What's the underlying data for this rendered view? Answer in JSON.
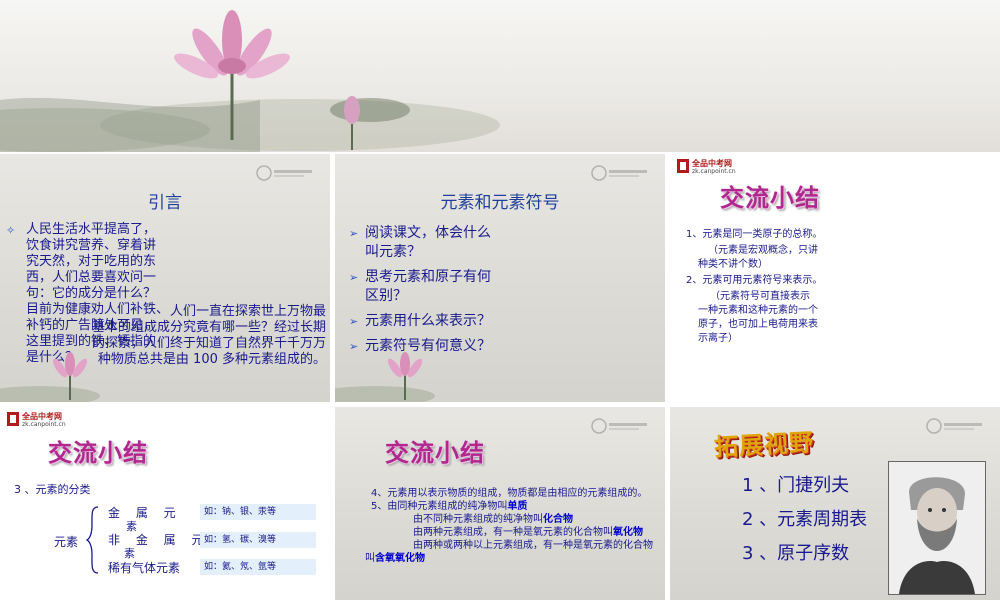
{
  "slides": {
    "s1": {
      "title": "引言",
      "bullet": "人民生活水平提高了，饮食讲究营养、穿着讲究天然，对于吃用的东西，人们总要喜欢问一句：它的成分是什么？目前为健康劝人们补铁、补钙的广告随处可见，这里提到的铁、钙指的是什么？",
      "bullet_lines": [
        "人民生活水平提高了，",
        "饮食讲究营养、穿着讲",
        "究天然，对于吃用的东",
        "西，人们总要喜欢问一",
        "句：它的成分是什么？",
        "目前为健康劝人们补铁、",
        "补钙的广告随处可见，",
        "这里提到的铁、钙指的",
        "是什么？"
      ],
      "overlay_lines": [
        "人们一直在探索世上万物最",
        "基本的组成成分究竟有哪一些？经过长期",
        "的探索，人们终于知道了自然界千千万万",
        "种物质总共是由 100 多种元素组成的。"
      ]
    },
    "s2": {
      "title": "元素和元素符号",
      "bullets": [
        [
          "阅读课文，体会什么",
          "叫元素？"
        ],
        [
          "思考元素和原子有何",
          "区别？"
        ],
        [
          "元素用什么来表示？"
        ],
        [
          "元素符号有何意义？"
        ]
      ]
    },
    "s3": {
      "logo_text": "全品中考网",
      "logo_sub": "zk.canpoint.cn",
      "title": "交流小结",
      "lines": [
        "1、元素是同一类原子的总称。",
        "（元素是宏观概念，只讲",
        "种类不讲个数）",
        "2、元素可用元素符号来表示。",
        "（元素符号可直接表示",
        "一种元素和这种元素的一个",
        "原子，也可加上电荷用来表",
        "示离子）"
      ]
    },
    "s4": {
      "logo_text": "全品中考网",
      "logo_sub": "zk.canpoint.cn",
      "title": "交流小结",
      "heading": "3 、元素的分类",
      "root_label": "元素",
      "categories": [
        {
          "label_main": "金 属 元",
          "label_wrap": "素",
          "examples": "如：钠、银、汞等"
        },
        {
          "label_main": "非 金 属 元",
          "label_wrap": "素",
          "examples": "如：氢、碳、溴等"
        },
        {
          "label_main": "稀有气体元素",
          "label_wrap": "",
          "examples": "如：氦、氖、氩等"
        }
      ]
    },
    "s5": {
      "title": "交流小结",
      "p1": "4、元素用以表示物质的组成，物质都是由相应的元素组成的。",
      "p2_pre": "5、由同种元素组成的纯净物叫",
      "p2_key": "单质",
      "p3_pre": "由不同种元素组成的纯净物叫",
      "p3_key": "化合物",
      "p4_pre": "由两种元素组成，有一种是氧元素的化合物叫",
      "p4_key": "氧化物",
      "p5_pre": "由两种或两种以上元素组成，有一种是氧元素的化合物叫",
      "p5_key": "含氧氧化物"
    },
    "s6": {
      "title": "拓展视野",
      "items": [
        "1 、门捷列夫",
        "2 、元素周期表",
        "3 、原子序数"
      ]
    }
  },
  "colors": {
    "title_blue": "#1f3f9a",
    "text_navy": "#1a1a8c",
    "magenta_title": "#b0288e",
    "gold_title": "#e0a40c",
    "lotus_pink": "#d98fb8"
  }
}
